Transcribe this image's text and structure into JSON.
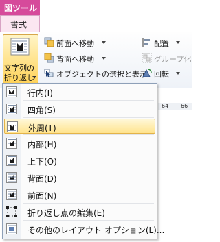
{
  "context_tab": {
    "label": "図ツール"
  },
  "ribbon_tab": {
    "label": "書式"
  },
  "wrap_button": {
    "label_line1": "文字列の",
    "label_line2": "折り返し"
  },
  "arrange": {
    "bring_forward": "前面へ移動",
    "send_backward": "背面へ移動",
    "selection_pane": "オブジェクトの選択と表示",
    "align": "配置",
    "group": "グループ化",
    "rotate": "回転"
  },
  "ruler": {
    "ticks": [
      "64",
      "66"
    ]
  },
  "menu": {
    "items": [
      {
        "label": "行内(I)"
      },
      {
        "label": "四角(S)"
      },
      {
        "label": "外周(T)",
        "selected": true
      },
      {
        "label": "内部(H)"
      },
      {
        "label": "上下(O)"
      },
      {
        "label": "背面(D)"
      },
      {
        "label": "前面(N)"
      },
      {
        "label": "折り返し点の編集(E)"
      },
      {
        "label": "その他のレイアウト オプション(L)..."
      }
    ]
  },
  "colors": {
    "context_tab": "#d64a9b",
    "highlight": "#ffe38d",
    "highlight_border": "#e3b349"
  }
}
